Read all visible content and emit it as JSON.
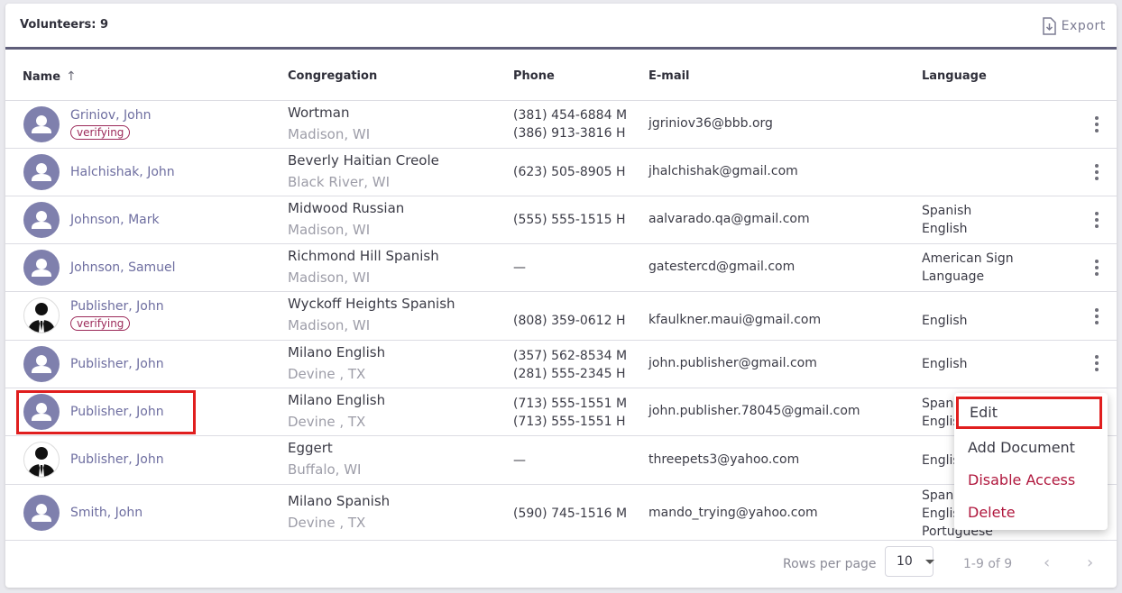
{
  "header": {
    "title": "Volunteers: 9",
    "export_label": "Export"
  },
  "columns": {
    "name": "Name",
    "congregation": "Congregation",
    "phone": "Phone",
    "email": "E-mail",
    "language": "Language"
  },
  "rows": [
    {
      "name": "Griniov, John",
      "badge": "verifying",
      "cong": "Wortman",
      "loc": "Madison, WI",
      "phone1": "(381) 454-6884 M",
      "phone2": "(386) 913-3816 H",
      "email": "jgriniov36@bbb.org",
      "lang1": "",
      "lang2": ""
    },
    {
      "name": "Halchishak, John",
      "badge": "",
      "cong": "Beverly Haitian Creole",
      "loc": "Black River, WI",
      "phone1": "(623) 505-8905 H",
      "phone2": "",
      "email": "jhalchishak@gmail.com",
      "lang1": "",
      "lang2": ""
    },
    {
      "name": "Johnson, Mark",
      "badge": "",
      "cong": "Midwood Russian",
      "loc": "Madison, WI",
      "phone1": "(555) 555-1515 H",
      "phone2": "",
      "email": "aalvarado.qa@gmail.com",
      "lang1": "Spanish",
      "lang2": "English"
    },
    {
      "name": "Johnson, Samuel",
      "badge": "",
      "cong": "Richmond Hill Spanish",
      "loc": "Madison, WI",
      "phone1": "—",
      "phone2": "",
      "email": "gatestercd@gmail.com",
      "lang1": "American Sign",
      "lang2": "Language"
    },
    {
      "name": "Publisher, John",
      "badge": "verifying",
      "cong": "Wyckoff Heights Spanish",
      "loc": "Madison, WI",
      "phone1": "(808) 359-0612 H",
      "phone2": "",
      "email": "kfaulkner.maui@gmail.com",
      "lang1": "English",
      "lang2": ""
    },
    {
      "name": "Publisher, John",
      "badge": "",
      "cong": "Milano English",
      "loc": "Devine , TX",
      "phone1": "(357) 562-8534 M",
      "phone2": "(281) 555-2345 H",
      "email": "john.publisher@gmail.com",
      "lang1": "English",
      "lang2": ""
    },
    {
      "name": "Publisher, John",
      "badge": "",
      "cong": "Milano English",
      "loc": "Devine , TX",
      "phone1": "(713) 555-1551 M",
      "phone2": "(713) 555-1551 H",
      "email": "john.publisher.78045@gmail.com",
      "lang1": "Span",
      "lang2": "Englis"
    },
    {
      "name": "Publisher, John",
      "badge": "",
      "cong": "Eggert",
      "loc": "Buffalo, WI",
      "phone1": "—",
      "phone2": "",
      "email": "threepets3@yahoo.com",
      "lang1": "Englis",
      "lang2": ""
    },
    {
      "name": "Smith, John",
      "badge": "",
      "cong": "Milano Spanish",
      "loc": "Devine , TX",
      "phone1": "(590) 745-1516 M",
      "phone2": "",
      "email": "mando_trying@yahoo.com",
      "lang1": "Span",
      "lang2": "Englis",
      "lang3": "Portuguese"
    }
  ],
  "menu": {
    "edit": "Edit",
    "add_document": "Add Document",
    "disable_access": "Disable Access",
    "delete": "Delete"
  },
  "footer": {
    "rows_per_page_label": "Rows per page",
    "rows_per_page_value": "10",
    "range": "1-9 of 9",
    "prev": "‹",
    "next": "›"
  },
  "colors": {
    "accent": "#6e6ea0",
    "header_rule": "#5f5e7a",
    "danger": "#b0173d",
    "highlight": "#e01e1e",
    "avatar": "#7f80ad"
  }
}
